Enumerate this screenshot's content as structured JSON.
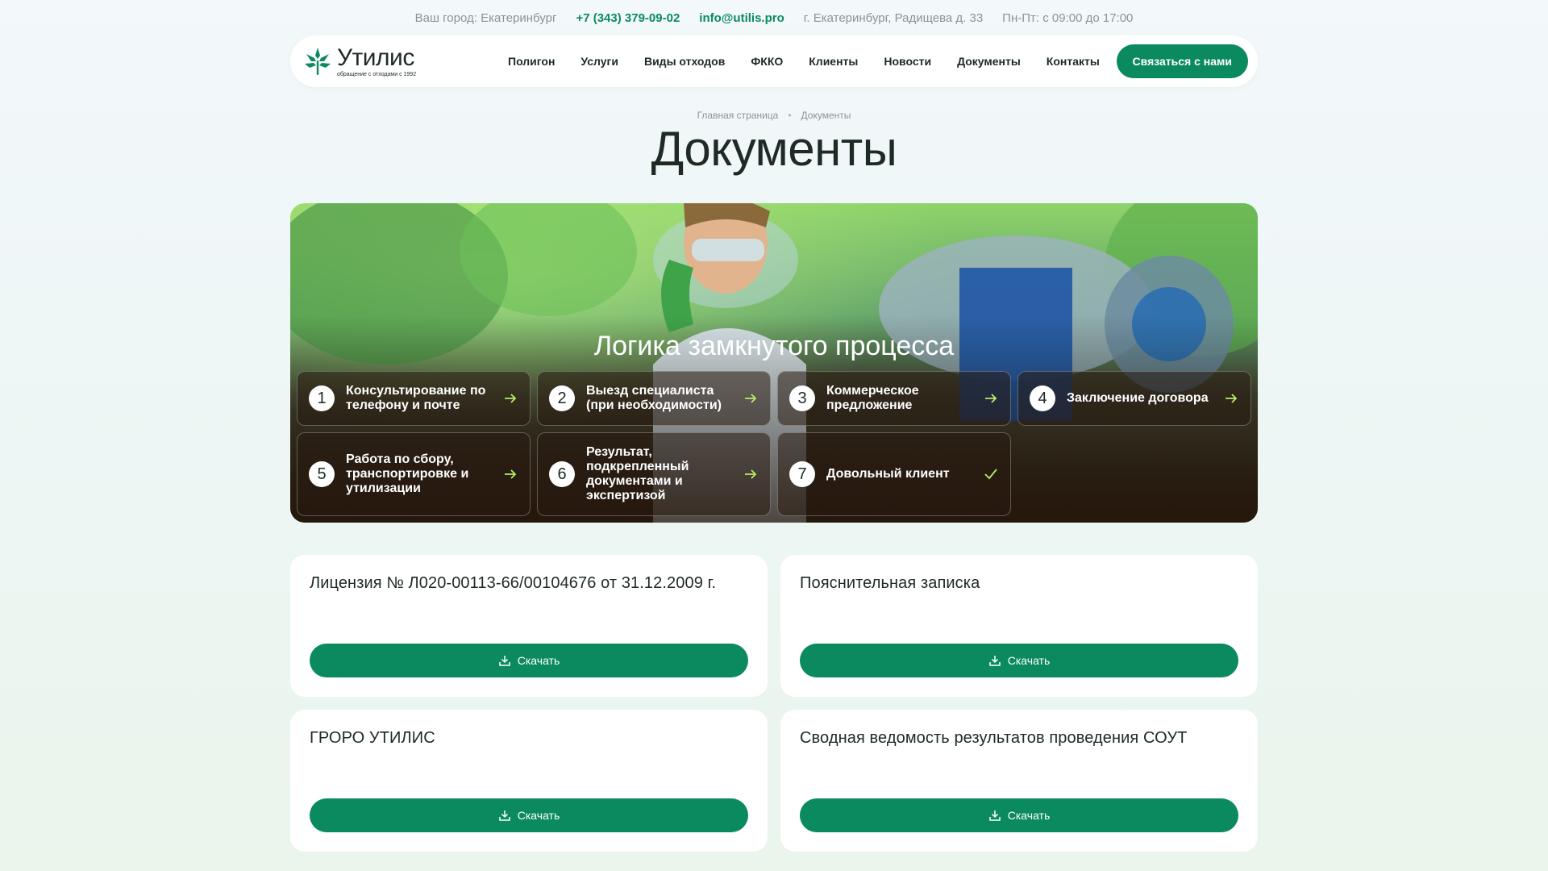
{
  "topbar": {
    "city": "Ваш город: Екатеринбург",
    "phone": "+7 (343) 379-09-02",
    "email": "info@utilis.pro",
    "address": "г. Екатеринбург, Радищева д. 33",
    "hours": "Пн-Пт: с 09:00 до 17:00"
  },
  "logo": {
    "name": "Утилис",
    "tagline": "обращение с отходами с 1992"
  },
  "nav": {
    "items": [
      "Полигон",
      "Услуги",
      "Виды отходов",
      "ФККО",
      "Клиенты",
      "Новости",
      "Документы",
      "Контакты"
    ],
    "cta": "Связаться с нами"
  },
  "breadcrumb": [
    "Главная страница",
    "Документы"
  ],
  "page_title": "Документы",
  "hero": {
    "title": "Логика замкнутого процесса",
    "steps": [
      {
        "num": "1",
        "label": "Консультирование по телефону и почте",
        "icon": "arrow-right-icon"
      },
      {
        "num": "2",
        "label": "Выезд специалиста (при необходимости)",
        "icon": "arrow-right-icon"
      },
      {
        "num": "3",
        "label": "Коммерческое предложение",
        "icon": "arrow-right-icon"
      },
      {
        "num": "4",
        "label": "Заключение договора",
        "icon": "arrow-right-icon"
      },
      {
        "num": "5",
        "label": "Работа по сбору, транспортировке и утилизации",
        "icon": "arrow-right-icon"
      },
      {
        "num": "6",
        "label": "Результат, подкрепленный документами и экспертизой",
        "icon": "arrow-right-icon"
      },
      {
        "num": "7",
        "label": "Довольный клиент",
        "icon": "check-icon"
      }
    ]
  },
  "documents": [
    {
      "title": "Лицензия № Л020-00113-66/00104676 от 31.12.2009 г.",
      "button": "Скачать"
    },
    {
      "title": "Пояснительная записка",
      "button": "Скачать"
    },
    {
      "title": "ГРОРО УТИЛИС",
      "button": "Скачать"
    },
    {
      "title": "Сводная ведомость результатов проведения СОУТ",
      "button": "Скачать"
    }
  ],
  "colors": {
    "brand_green": "#0b8a5f",
    "text_dark": "#1d2a25",
    "muted": "#8a9592"
  }
}
